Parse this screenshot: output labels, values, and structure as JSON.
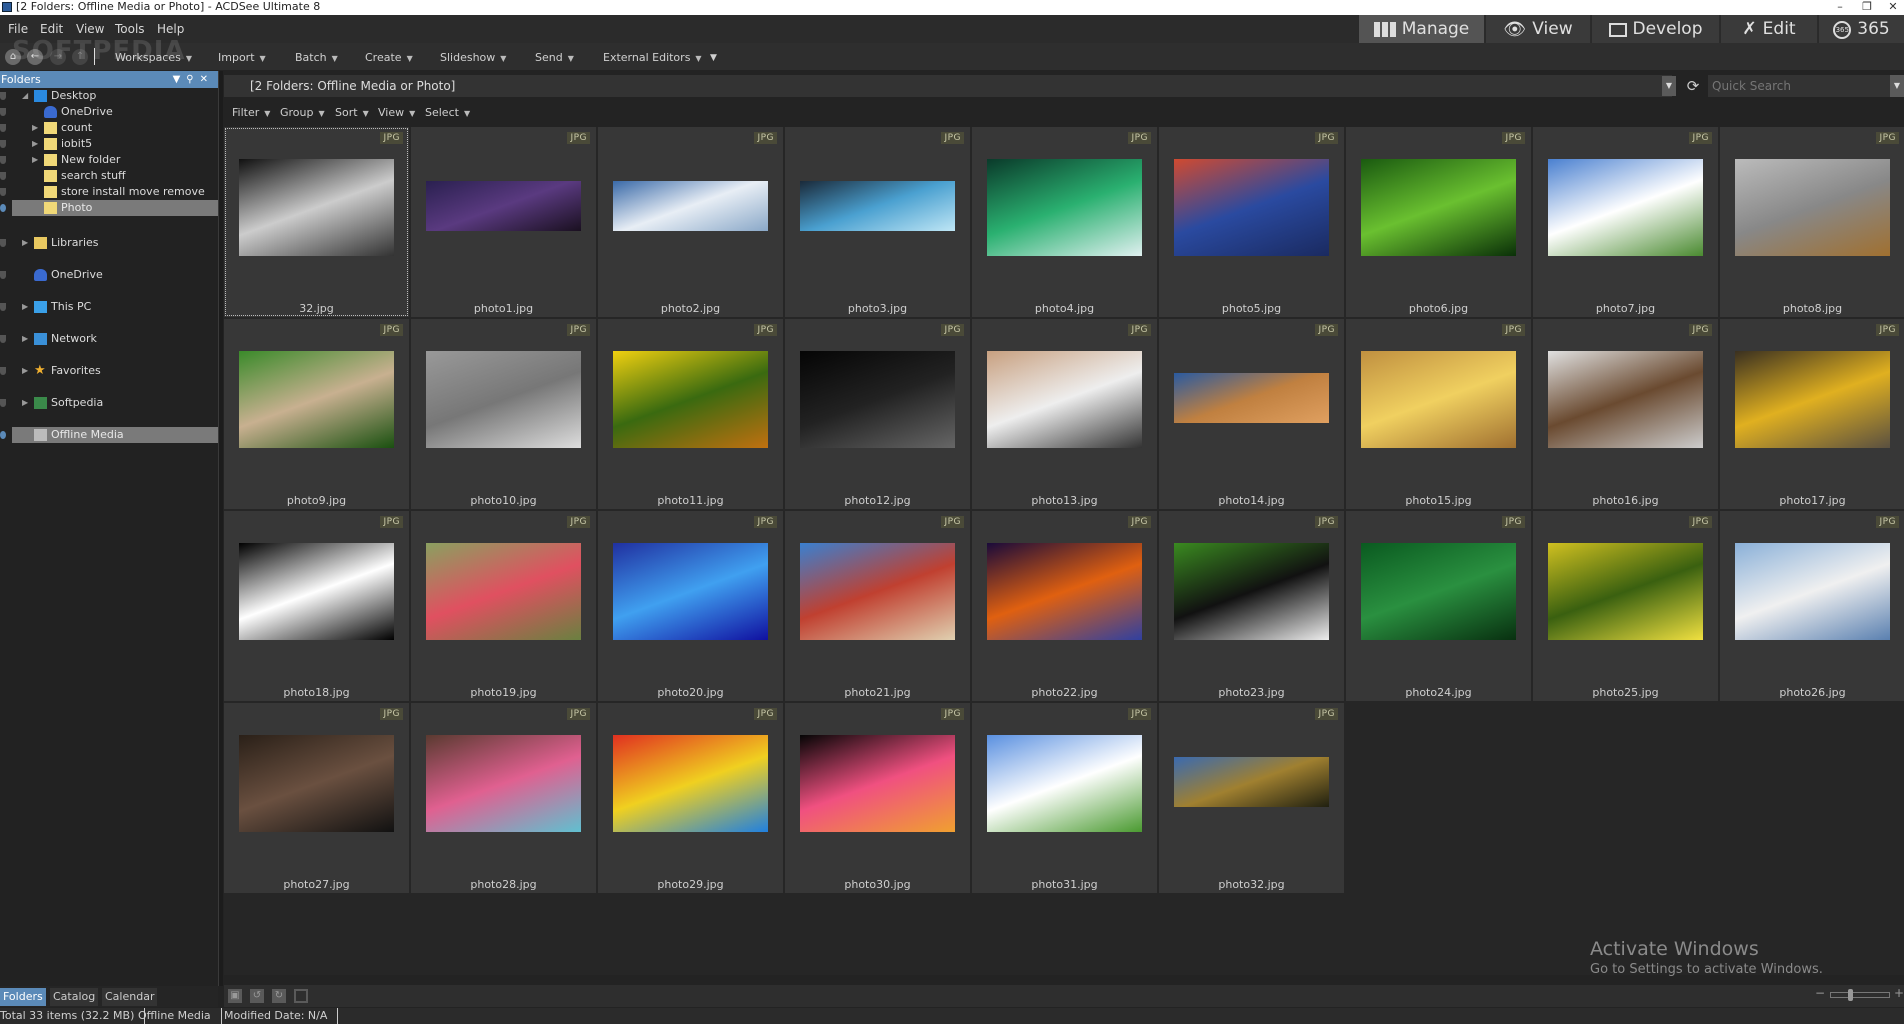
{
  "window": {
    "title": "[2 Folders: Offline Media or Photo] - ACDSee Ultimate 8",
    "controls": [
      "minimize",
      "restore",
      "close"
    ]
  },
  "menu": [
    "File",
    "Edit",
    "View",
    "Tools",
    "Help"
  ],
  "modes": [
    {
      "label": "Manage",
      "icon": "grid-icon",
      "active": true
    },
    {
      "label": "View",
      "icon": "eye-icon",
      "active": false
    },
    {
      "label": "Develop",
      "icon": "picture-icon",
      "active": false
    },
    {
      "label": "Edit",
      "icon": "tools-icon",
      "active": false
    },
    {
      "label": "365",
      "icon": "365-icon",
      "active": false
    }
  ],
  "watermark": "SOFTPEDIA",
  "toolbar": [
    "Workspaces",
    "Import",
    "Batch",
    "Create",
    "Slideshow",
    "Send",
    "External Editors"
  ],
  "folders_panel": {
    "title": "Folders",
    "tree": [
      {
        "label": "Desktop",
        "level": 1,
        "expanded": true,
        "icon": "desktop-icon"
      },
      {
        "label": "OneDrive",
        "level": 2,
        "icon": "onedrive-icon"
      },
      {
        "label": "count",
        "level": 2,
        "expandable": true,
        "icon": "folder-icon"
      },
      {
        "label": "iobit5",
        "level": 2,
        "expandable": true,
        "icon": "folder-icon"
      },
      {
        "label": "New folder",
        "level": 2,
        "expandable": true,
        "icon": "folder-icon"
      },
      {
        "label": "search stuff",
        "level": 2,
        "icon": "folder-icon"
      },
      {
        "label": "store install move remove",
        "level": 2,
        "icon": "folder-icon"
      },
      {
        "label": "Photo",
        "level": 2,
        "icon": "folder-icon",
        "selected": true
      },
      {
        "label": "Libraries",
        "level": 1,
        "expandable": true,
        "icon": "libraries-icon"
      },
      {
        "label": "OneDrive",
        "level": 1,
        "icon": "onedrive-icon"
      },
      {
        "label": "This PC",
        "level": 1,
        "expandable": true,
        "icon": "computer-icon"
      },
      {
        "label": "Network",
        "level": 1,
        "expandable": true,
        "icon": "network-icon"
      },
      {
        "label": "Favorites",
        "level": 1,
        "expandable": true,
        "icon": "star-icon"
      },
      {
        "label": "Softpedia",
        "level": 1,
        "expandable": true,
        "icon": "user-icon"
      },
      {
        "label": "Offline Media",
        "level": 1,
        "icon": "offline-media-icon",
        "selected": true
      }
    ],
    "tabs": [
      {
        "label": "Folders",
        "active": true
      },
      {
        "label": "Catalog",
        "active": false
      },
      {
        "label": "Calendar",
        "active": false
      }
    ]
  },
  "path": "[2 Folders: Offline Media or Photo]",
  "quick_search": {
    "placeholder": "Quick Search",
    "value": ""
  },
  "filterbar": [
    "Filter",
    "Group",
    "Sort",
    "View",
    "Select"
  ],
  "files": [
    {
      "name": "32.jpg",
      "type": "JPG",
      "colors": [
        "#111",
        "#ccc",
        "#333"
      ],
      "focused": true
    },
    {
      "name": "photo1.jpg",
      "type": "JPG",
      "colors": [
        "#2a2050",
        "#5a3a80",
        "#1a1020"
      ],
      "pano": true
    },
    {
      "name": "photo2.jpg",
      "type": "JPG",
      "colors": [
        "#3a6aa8",
        "#e8eef5",
        "#8aa8c8"
      ],
      "pano": true
    },
    {
      "name": "photo3.jpg",
      "type": "JPG",
      "colors": [
        "#1a2a3a",
        "#4aa0d0",
        "#bfe6f5"
      ],
      "pano": true
    },
    {
      "name": "photo4.jpg",
      "type": "JPG",
      "colors": [
        "#0a3a2a",
        "#2ab070",
        "#e0f0f0"
      ]
    },
    {
      "name": "photo5.jpg",
      "type": "JPG",
      "colors": [
        "#d04a30",
        "#2a4aa0",
        "#1a2a60"
      ]
    },
    {
      "name": "photo6.jpg",
      "type": "JPG",
      "colors": [
        "#1a5a10",
        "#6ac030",
        "#0a3008"
      ]
    },
    {
      "name": "photo7.jpg",
      "type": "JPG",
      "colors": [
        "#4a80d0",
        "#ffffff",
        "#4a8a30"
      ]
    },
    {
      "name": "photo8.jpg",
      "type": "JPG",
      "colors": [
        "#bbbbbb",
        "#888",
        "#a07030"
      ]
    },
    {
      "name": "photo9.jpg",
      "type": "JPG",
      "colors": [
        "#3a8a2a",
        "#c8b090",
        "#1a5010"
      ]
    },
    {
      "name": "photo10.jpg",
      "type": "JPG",
      "colors": [
        "#999",
        "#777",
        "#ddd"
      ]
    },
    {
      "name": "photo11.jpg",
      "type": "JPG",
      "colors": [
        "#f0d010",
        "#3a6a10",
        "#c07010"
      ]
    },
    {
      "name": "photo12.jpg",
      "type": "JPG",
      "colors": [
        "#050505",
        "#222",
        "#666"
      ]
    },
    {
      "name": "photo13.jpg",
      "type": "JPG",
      "colors": [
        "#c8a080",
        "#eee",
        "#333"
      ]
    },
    {
      "name": "photo14.jpg",
      "type": "JPG",
      "colors": [
        "#2a5aa0",
        "#c08040",
        "#e0a060"
      ],
      "pano": true
    },
    {
      "name": "photo15.jpg",
      "type": "JPG",
      "colors": [
        "#c09040",
        "#f0d060",
        "#a07030"
      ]
    },
    {
      "name": "photo16.jpg",
      "type": "JPG",
      "colors": [
        "#e0e0e0",
        "#6a4a30",
        "#ccc"
      ]
    },
    {
      "name": "photo17.jpg",
      "type": "JPG",
      "colors": [
        "#3a3020",
        "#e0b020",
        "#5a5040"
      ]
    },
    {
      "name": "photo18.jpg",
      "type": "JPG",
      "colors": [
        "#000",
        "#fff",
        "#000"
      ]
    },
    {
      "name": "photo19.jpg",
      "type": "JPG",
      "colors": [
        "#8aa060",
        "#e05060",
        "#6a8040"
      ]
    },
    {
      "name": "photo20.jpg",
      "type": "JPG",
      "colors": [
        "#2030a0",
        "#40a0f0",
        "#1010a0"
      ]
    },
    {
      "name": "photo21.jpg",
      "type": "JPG",
      "colors": [
        "#3a80d0",
        "#c04030",
        "#e0d0b0"
      ]
    },
    {
      "name": "photo22.jpg",
      "type": "JPG",
      "colors": [
        "#1a0a3a",
        "#e06010",
        "#3040a0"
      ]
    },
    {
      "name": "photo23.jpg",
      "type": "JPG",
      "colors": [
        "#3a8a20",
        "#111",
        "#eee"
      ]
    },
    {
      "name": "photo24.jpg",
      "type": "JPG",
      "colors": [
        "#0a5a20",
        "#2a9040",
        "#083010"
      ]
    },
    {
      "name": "photo25.jpg",
      "type": "JPG",
      "colors": [
        "#d0c020",
        "#3a6010",
        "#f0e040"
      ]
    },
    {
      "name": "photo26.jpg",
      "type": "JPG",
      "colors": [
        "#8ab0d8",
        "#f0f0f0",
        "#5a80b0"
      ]
    },
    {
      "name": "photo27.jpg",
      "type": "JPG",
      "colors": [
        "#2a2018",
        "#6a5040",
        "#111"
      ]
    },
    {
      "name": "photo28.jpg",
      "type": "JPG",
      "colors": [
        "#5a3a30",
        "#e06090",
        "#60c0d0"
      ]
    },
    {
      "name": "photo29.jpg",
      "type": "JPG",
      "colors": [
        "#e03020",
        "#f0d020",
        "#2080e0"
      ]
    },
    {
      "name": "photo30.jpg",
      "type": "JPG",
      "colors": [
        "#050505",
        "#f05080",
        "#f0a030"
      ]
    },
    {
      "name": "photo31.jpg",
      "type": "JPG",
      "colors": [
        "#5a90e0",
        "#ffffff",
        "#4a9a30"
      ]
    },
    {
      "name": "photo32.jpg",
      "type": "JPG",
      "colors": [
        "#3a6ab0",
        "#a08030",
        "#202010"
      ],
      "pano": true
    }
  ],
  "watermark_os": {
    "line1": "Activate Windows",
    "line2": "Go to Settings to activate Windows."
  },
  "zoom_slider": {
    "minus": "−",
    "plus": "+",
    "value": 0.3
  },
  "status": {
    "items": "Total 33 items  (32.2 MB)",
    "location": "Offline Media",
    "modified": "Modified Date: N/A"
  }
}
